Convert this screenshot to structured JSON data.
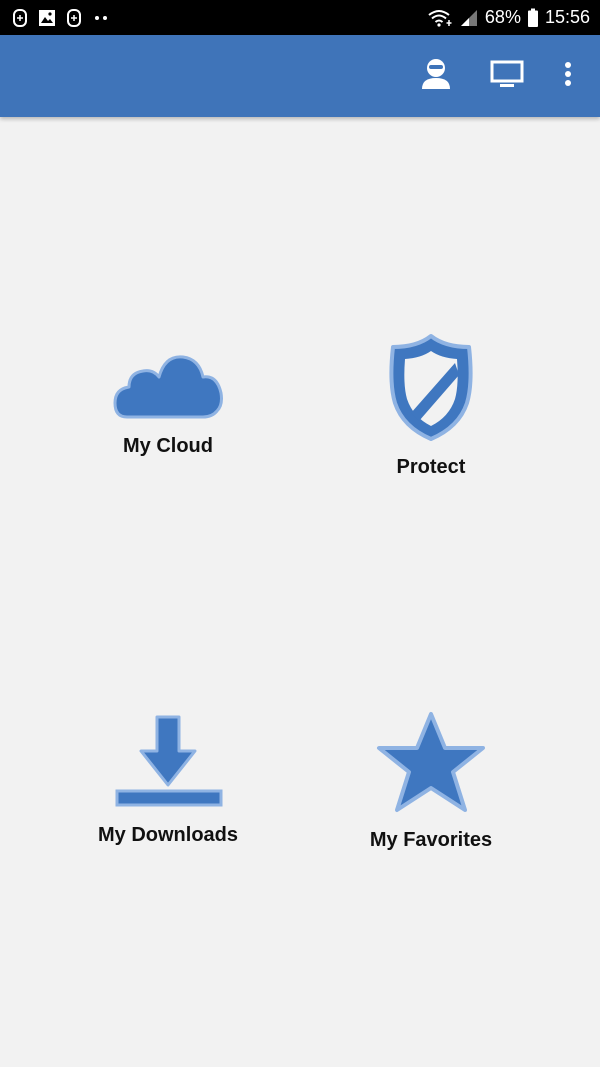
{
  "status_bar": {
    "left_icons": [
      "app-notification-icon",
      "image-notification-icon",
      "app-notification-icon",
      "more-notifications-icon"
    ],
    "battery": "68%",
    "time": "15:56",
    "right_icons": [
      "wifi-icon",
      "signal-icon",
      "battery-icon"
    ]
  },
  "app_bar": {
    "background": "#3f74b9",
    "actions": [
      "account-icon",
      "screen-icon",
      "more-vert-icon"
    ]
  },
  "tiles": [
    {
      "label": "My Cloud",
      "icon": "cloud-icon"
    },
    {
      "label": "Protect",
      "icon": "shield-icon"
    },
    {
      "label": "My Downloads",
      "icon": "download-icon"
    },
    {
      "label": "My Favorites",
      "icon": "star-icon"
    }
  ],
  "colors": {
    "accent": "#3f74b9",
    "icon_fill": "#3f77c0",
    "icon_stroke": "#8fb3e3",
    "background": "#f2f2f2"
  }
}
